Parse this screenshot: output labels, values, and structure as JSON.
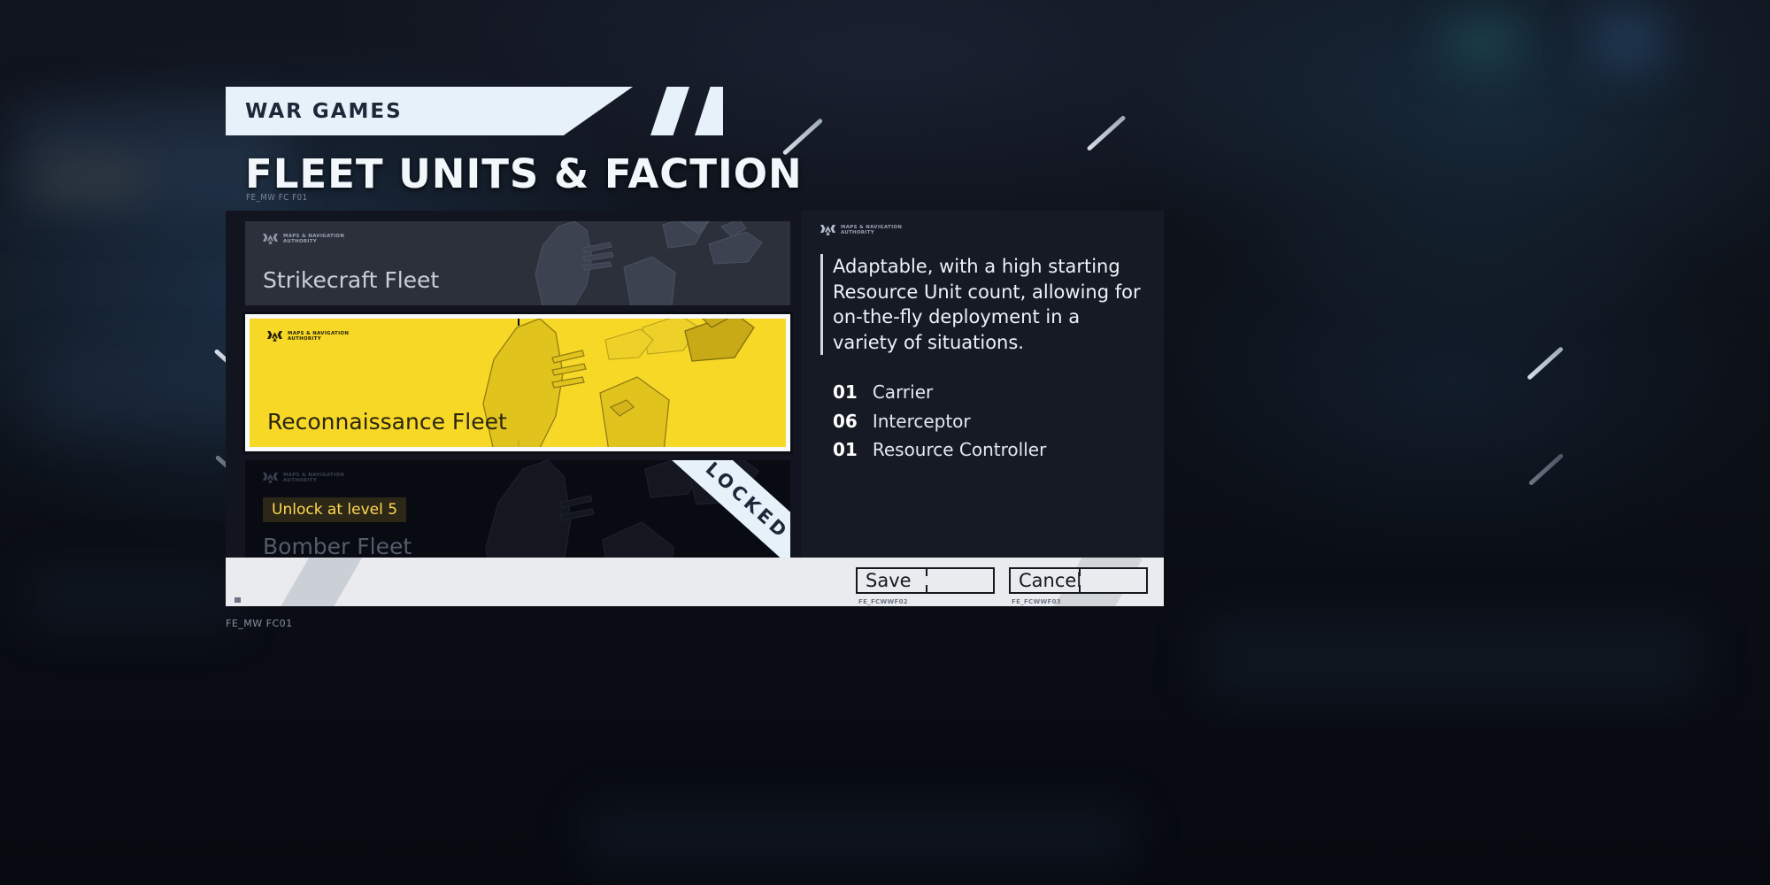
{
  "header": {
    "banner_label": "WAR GAMES",
    "title": "FLEET UNITS & FACTION",
    "title_code": "FE_MW FC F01"
  },
  "brand": {
    "line1": "MAPS & NAVIGATION",
    "line2": "AUTHORITY",
    "mark": "map-navigation-authority-logo"
  },
  "fleet_cards": [
    {
      "name": "Strikecraft Fleet",
      "state": "available",
      "badge": "",
      "ribbon": ""
    },
    {
      "name": "Reconnaissance Fleet",
      "state": "selected",
      "badge": "",
      "ribbon": ""
    },
    {
      "name": "Bomber Fleet",
      "state": "locked",
      "badge": "Unlock at level 5",
      "ribbon": "LOCKED"
    }
  ],
  "details": {
    "description": "Adaptable, with a high starting Resource Unit count, allowing for on-the-fly deployment in a variety of situations.",
    "units": [
      {
        "count": "01",
        "name": "Carrier"
      },
      {
        "count": "06",
        "name": "Interceptor"
      },
      {
        "count": "01",
        "name": "Resource Controller"
      }
    ]
  },
  "footer": {
    "save_label": "Save",
    "save_code": "FE_FCWWF02",
    "cancel_label": "Cancel",
    "cancel_code": "FE_FCWWF03",
    "screen_code": "FE_MW FC01"
  },
  "colors": {
    "accent_yellow": "#f7d827",
    "panel_dark": "#12151f",
    "panel_darker": "#161a25",
    "banner_light": "#e7f1fa",
    "footer_light": "#e9ebee",
    "badge_text": "#ffd84d"
  }
}
